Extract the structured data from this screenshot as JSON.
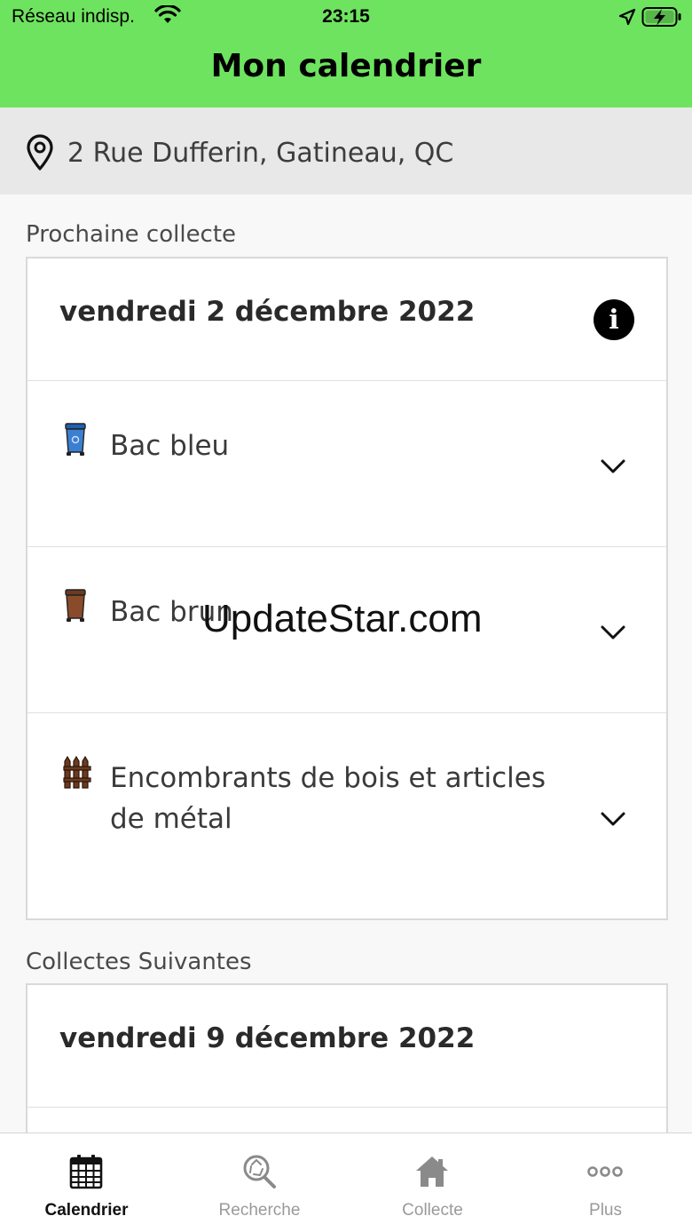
{
  "status_bar": {
    "carrier": "Réseau indisp.",
    "time": "23:15"
  },
  "header": {
    "title": "Mon calendrier"
  },
  "address": {
    "icon": "map-pin-icon",
    "text": "2 Rue Dufferin, Gatineau, QC"
  },
  "next_collection": {
    "section_label": "Prochaine collecte",
    "date": "vendredi 2 décembre 2022",
    "items": [
      {
        "label": "Bac bleu",
        "icon": "blue-bin-icon",
        "color": "#3b7fd0"
      },
      {
        "label": "Bac brun",
        "icon": "brown-bin-icon",
        "color": "#8a4b2a"
      },
      {
        "label": "Encombrants de bois et articles de métal",
        "icon": "fence-icon",
        "color": "#6b3a1f"
      }
    ]
  },
  "following_collections": {
    "section_label": "Collectes Suivantes",
    "date": "vendredi 9 décembre 2022"
  },
  "watermark": "UpdateStar.com",
  "tabs": [
    {
      "label": "Calendrier",
      "icon": "calendar-icon",
      "active": true
    },
    {
      "label": "Recherche",
      "icon": "recycle-search-icon",
      "active": false
    },
    {
      "label": "Collecte",
      "icon": "home-icon",
      "active": false
    },
    {
      "label": "Plus",
      "icon": "more-dots-icon",
      "active": false
    }
  ],
  "colors": {
    "header_green": "#6ee35f",
    "inactive_tab": "#9a9a9a"
  }
}
